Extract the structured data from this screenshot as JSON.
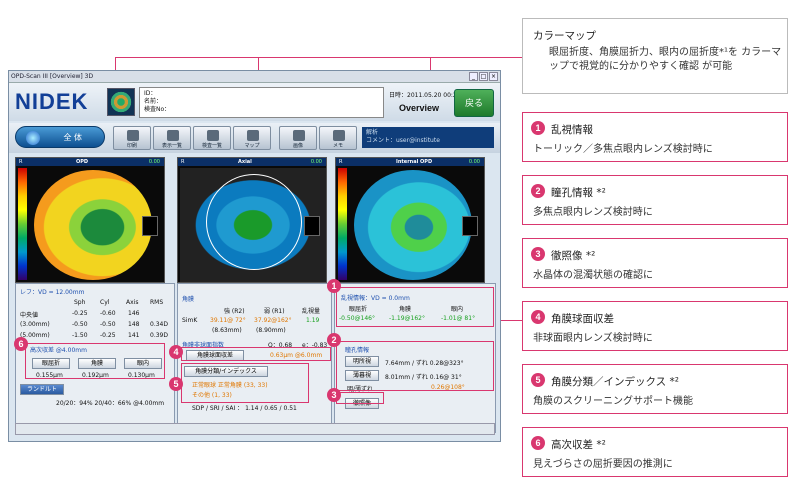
{
  "window": {
    "title": "OPD-Scan III [Overview] 3D",
    "back": "戻る",
    "date": "日時：2011.05.20 00:21",
    "overview": "Overview",
    "id": "ID：",
    "name": "名前：",
    "exam": "検査No：",
    "logo": "NIDEK",
    "main_btn": "全 体",
    "toolbar": [
      "印刷",
      "表示一覧",
      "検査一覧",
      "マップ",
      "画像",
      "メモ"
    ],
    "comment": "コメント：user@institute",
    "comment_label": "解析"
  },
  "maps": [
    {
      "label": "OPD",
      "val": "0.00"
    },
    {
      "label": "Axial",
      "val": "0.00"
    },
    {
      "label": "Internal OPD",
      "val": "0.00"
    }
  ],
  "refraction": {
    "title": "レフ：VD = 12.00mm",
    "cols": [
      "Sph",
      "Cyl",
      "Axis",
      "RMS"
    ],
    "rows": [
      {
        "l": "中央値",
        "v": [
          "-0.25",
          "-0.60",
          "146",
          ""
        ]
      },
      {
        "l": "(3.00mm)",
        "v": [
          "-0.50",
          "-0.50",
          "148",
          "0.34D"
        ]
      },
      {
        "l": "(5.00mm)",
        "v": [
          "-1.50",
          "-0.25",
          "141",
          "0.39D"
        ]
      }
    ],
    "hoa_title": "高次収差 @4.00mm",
    "hoa_btns": [
      "眼屈折",
      "角膜",
      "眼内"
    ],
    "hoa_vals": [
      "0.155μm",
      "0.192μm",
      "0.130μm"
    ],
    "landolt_btn": "ランドルト",
    "landolt": "20/20：94%  20/40：66% @4.00mm"
  },
  "cornea": {
    "title": "角膜",
    "h": [
      "強 (R2)",
      "弱 (R1)",
      "乱視量"
    ],
    "rowlabel": "SimK",
    "v": [
      "39.11@ 72°",
      "37.92@162°",
      "1.19"
    ],
    "v2": [
      "(8.63mm)",
      "(8.90mm)",
      ""
    ],
    "asp_title": "角膜非球面指数",
    "q": "Q：0.68",
    "e": "e：-0.83",
    "sa_btn": "角膜球面収差",
    "sa": "0.63μm @6.0mm",
    "idx_btn": "角膜分類/インデックス",
    "idx1": "正常眼球 正常角膜 (33, 33)",
    "idx2": "その他 (1, 33)",
    "sdp": "SDP / SRI / SAI ： 1.14 / 0.65 / 0.51"
  },
  "ast": {
    "title": "乱視情報：VD = 0.0mm",
    "h": [
      "眼屈折",
      "角膜",
      "眼内"
    ],
    "v": [
      "-0.50@146°",
      "-1.19@162°",
      "-1.01@ 81°"
    ]
  },
  "pupil": {
    "title": "瞳孔情報",
    "rows": [
      {
        "btn": "明所視",
        "v": "7.64mm / ずれ 0.28@323°"
      },
      {
        "btn": "薄暮視",
        "v": "8.01mm / ずれ 0.16@ 31°"
      },
      {
        "btn": "明/薄ずれ",
        "v": "0.26@108°"
      }
    ],
    "retro": "徹照像"
  },
  "cards": [
    {
      "title": "カラーマップ",
      "desc": "眼屈折度、角膜屈折力、眼内の屈折度*¹を カラーマップで視覚的に分かりやすく確認 が可能"
    },
    {
      "num": "1",
      "title": "乱視情報",
      "desc": "トーリック／多焦点眼内レンズ検討時に"
    },
    {
      "num": "2",
      "title": "瞳孔情報 *²",
      "desc": "多焦点眼内レンズ検討時に"
    },
    {
      "num": "3",
      "title": "徹照像 *²",
      "desc": "水晶体の混濁状態の確認に"
    },
    {
      "num": "4",
      "title": "角膜球面収差",
      "desc": "非球面眼内レンズ検討時に"
    },
    {
      "num": "5",
      "title": "角膜分類／インデックス *²",
      "desc": "角膜のスクリーニングサポート機能"
    },
    {
      "num": "6",
      "title": "高次収差 *²",
      "desc": "見えづらさの屈折要因の推測に"
    }
  ]
}
